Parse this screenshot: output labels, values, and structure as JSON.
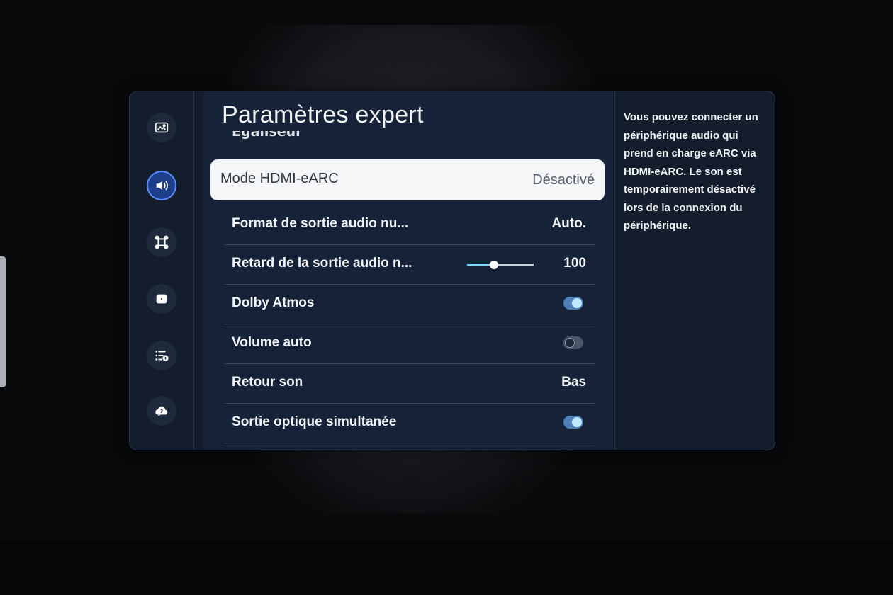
{
  "title": "Paramètres expert",
  "partial_row_label": "Égaliseur",
  "sidebar": {
    "items": [
      {
        "icon": "picture-icon",
        "active": false
      },
      {
        "icon": "sound-icon",
        "active": true
      },
      {
        "icon": "connection-icon",
        "active": false
      },
      {
        "icon": "general-icon",
        "active": false
      },
      {
        "icon": "support-list-icon",
        "active": false
      },
      {
        "icon": "help-cloud-icon",
        "active": false
      }
    ]
  },
  "settings": [
    {
      "label": "Mode HDMI-eARC",
      "value": "Désactivé",
      "focused": true
    },
    {
      "label": "Format de sortie audio nu...",
      "value": "Auto."
    },
    {
      "label": "Retard de la sortie audio n...",
      "value": "100",
      "slider_level": 0.4
    },
    {
      "label": "Dolby Atmos",
      "toggle": "on"
    },
    {
      "label": "Volume auto",
      "toggle": "off"
    },
    {
      "label": "Retour son",
      "value": "Bas"
    },
    {
      "label": "Sortie optique simultanée",
      "toggle": "on"
    }
  ],
  "help_text": "Vous pouvez connecter un périphérique audio qui prend en charge eARC via HDMI-eARC. Le son est temporairement désactivé lors de la connexion du périphérique.",
  "colors": {
    "accent": "#5a8cff",
    "toggle_on": "#4d7fb8",
    "focus_bg": "#f4f6f8"
  }
}
